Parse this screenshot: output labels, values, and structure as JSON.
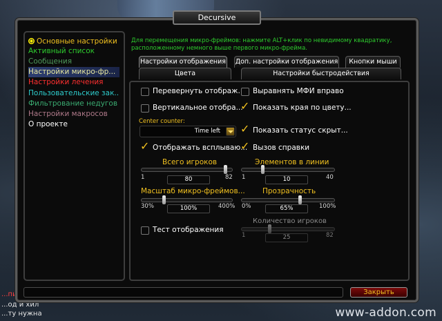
{
  "window": {
    "title": "Decursive",
    "close_label": "Закрыть"
  },
  "sidebar": {
    "items": [
      {
        "label": "Основные настройки",
        "color": "#f0c020"
      },
      {
        "label": "Активный список",
        "color": "#2ecc2e"
      },
      {
        "label": "Сообщения",
        "color": "#4e9a5a"
      },
      {
        "label": "Настройки микро-фр...",
        "color": "#e8e8a0"
      },
      {
        "label": "Настройки лечения",
        "color": "#ff3030"
      },
      {
        "label": "Пользовательские зак...",
        "color": "#2ecccc"
      },
      {
        "label": "Фильтрование недугов",
        "color": "#3aaa70"
      },
      {
        "label": "Настройки макросов",
        "color": "#b07a8a"
      },
      {
        "label": "О проекте",
        "color": "#ffffff"
      }
    ]
  },
  "hint": "Для перемещения микро-фреймов: нажмите ALT+клик по невидимому квадратику, расположенному немного выше первого микро-фрейма.",
  "tabs": {
    "row1": [
      "Настройки отображения",
      "Доп. настройки отображения",
      "Кнопки мыши"
    ],
    "row2": [
      "Цвета",
      "Настройки быстродействия"
    ]
  },
  "options": {
    "flip": {
      "label": "Перевернуть отображ...",
      "checked": false
    },
    "align_mfi": {
      "label": "Выравнять МФИ вправо",
      "checked": false
    },
    "vertical": {
      "label": "Вертикальное отобра...",
      "checked": false
    },
    "show_edges": {
      "label": "Показать края по цвету...",
      "checked": true
    },
    "show_hidden_status": {
      "label": "Показать статус скрыт...",
      "checked": true
    },
    "show_popup": {
      "label": "Отображать всплываю...",
      "checked": true
    },
    "call_help": {
      "label": "Вызов справки",
      "checked": true
    },
    "test_display": {
      "label": "Тест отображения",
      "checked": false
    }
  },
  "center_counter": {
    "label": "Center counter:",
    "value": "Time left"
  },
  "sliders": {
    "total_players": {
      "label": "Всего игроков",
      "min": "1",
      "max": "82",
      "value": "80"
    },
    "elements_per_line": {
      "label": "Элементов в линии",
      "min": "1",
      "max": "40",
      "value": "10"
    },
    "scale": {
      "label": "Масштаб микро-фреймов...",
      "min": "30%",
      "max": "400%",
      "value": "100%"
    },
    "transparency": {
      "label": "Прозрачность",
      "min": "0%",
      "max": "100%",
      "value": "65%"
    },
    "player_count": {
      "label": "Количество игроков",
      "min": "1",
      "max": "82",
      "value": "25"
    }
  },
  "background_chat": [
    "...пить Т'Зена",
    "...од и хил",
    "...ту нужна"
  ],
  "watermark": "www-addon.com"
}
